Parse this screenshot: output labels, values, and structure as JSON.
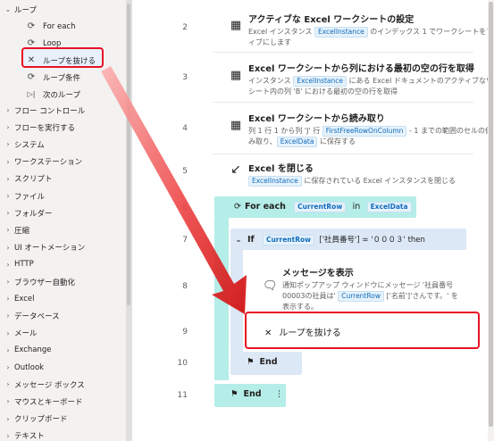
{
  "sidebar": {
    "loop_group": "ループ",
    "sub_items": [
      {
        "icon": "loop-icon",
        "glyph": "⟳",
        "label": "For each"
      },
      {
        "icon": "loop-icon",
        "glyph": "⟳",
        "label": "Loop"
      },
      {
        "icon": "close-icon",
        "glyph": "✕",
        "label": "ループを抜ける"
      },
      {
        "icon": "loop-condition-icon",
        "glyph": "⟳",
        "label": "ループ条件"
      },
      {
        "icon": "next-loop-icon",
        "glyph": "▷|",
        "label": "次のループ"
      }
    ],
    "groups": [
      "フロー コントロール",
      "フローを実行する",
      "システム",
      "ワークステーション",
      "スクリプト",
      "ファイル",
      "フォルダー",
      "圧縮",
      "UI オートメーション",
      "HTTP",
      "ブラウザー自動化",
      "Excel",
      "データベース",
      "メール",
      "Exchange",
      "Outlook",
      "メッセージ ボックス",
      "マウスとキーボード",
      "クリップボード",
      "テキスト"
    ]
  },
  "flow": {
    "steps": [
      {
        "line": "2",
        "icon": "excel-sheet-icon",
        "title": "アクティブな Excel ワークシートの設定",
        "desc_parts": [
          "Excel インスタンス ",
          "ExcelInstance",
          " のインデックス 1 でワークシートをアクティブにします"
        ]
      },
      {
        "line": "3",
        "icon": "excel-sheet-icon",
        "title": "Excel ワークシートから列における最初の空の行を取得",
        "desc_parts": [
          "インスタンス ",
          "ExcelInstance",
          " にある Excel ドキュメントのアクティブなワークシート内の列 'B' における最初の空の行を取得"
        ]
      },
      {
        "line": "4",
        "icon": "excel-sheet-icon",
        "title": "Excel ワークシートから読み取り",
        "desc_parts": [
          "列 1 行 1 から列 'J' 行 ",
          "FirstFreeRowOnColumn",
          " - 1 までの範囲のセルの値を読み取り、",
          "ExcelData",
          " に保存する"
        ]
      },
      {
        "line": "5",
        "icon": "close-excel-icon",
        "title": "Excel を閉じる",
        "desc_parts": [
          "ExcelInstance",
          " に保存されている Excel インスタンスを閉じる"
        ]
      }
    ],
    "foreach": {
      "line": "6",
      "keyword": "For each",
      "var": "CurrentRow",
      "in": "in",
      "source": "ExcelData"
    },
    "if": {
      "line": "7",
      "keyword": "If",
      "var": "CurrentRow",
      "cond": "['社員番号'] = '０００３' then"
    },
    "message": {
      "line": "8",
      "title": "メッセージを表示",
      "desc_a": "通知ポップアップ ウィンドウにメッセージ '社員番号00003の社員は' ",
      "var": "CurrentRow",
      "desc_b": " ['名前']'さんです。' を表示する。"
    },
    "exit": {
      "line": "9",
      "label": "ループを抜ける"
    },
    "if_end": {
      "line": "10",
      "label": "End"
    },
    "foreach_end": {
      "line": "11",
      "label": "End",
      "more": "⋮"
    }
  },
  "colors": {
    "highlight": "#e81123",
    "loop_bar": "#b5ede8",
    "if_bar": "#dce8f6",
    "variable": "#0f6cbd"
  }
}
